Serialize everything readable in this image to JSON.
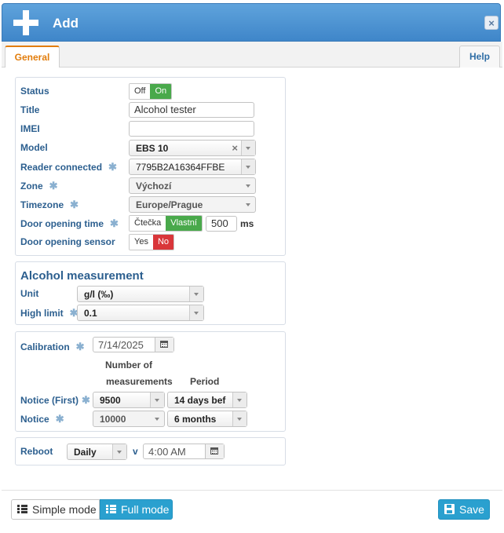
{
  "dialog": {
    "title": "Add",
    "close_label": "×"
  },
  "tabs": {
    "general": "General",
    "help": "Help"
  },
  "general": {
    "status_label": "Status",
    "status_off": "Off",
    "status_on": "On",
    "title_label": "Title",
    "title_value": "Alcohol tester",
    "imei_label": "IMEI",
    "imei_value": "",
    "model_label": "Model",
    "model_value": "EBS 10",
    "model_clear": "×",
    "reader_label": "Reader connected",
    "reader_value": "7795B2A16364FFBE",
    "zone_label": "Zone",
    "zone_value": "Výchozí",
    "timezone_label": "Timezone",
    "timezone_value": "Europe/Prague",
    "door_time_label": "Door opening time",
    "door_time_opt1": "Čtečka",
    "door_time_opt2": "Vlastní",
    "door_time_value": "500",
    "door_time_unit": "ms",
    "door_sensor_label": "Door opening sensor",
    "door_sensor_yes": "Yes",
    "door_sensor_no": "No"
  },
  "alcohol": {
    "heading": "Alcohol measurement",
    "unit_label": "Unit",
    "unit_value": "g/l (‰)",
    "high_limit_label": "High limit",
    "high_limit_value": "0.1"
  },
  "calibration": {
    "label": "Calibration",
    "date_value": "7/14/2025",
    "col_measure_line1": "Number of",
    "col_measure_line2": "measurements",
    "col_period": "Period",
    "notice_first_label": "Notice (First)",
    "notice_first_count": "9500",
    "notice_first_period": "14 days bef",
    "notice_label": "Notice",
    "notice_count": "10000",
    "notice_period": "6 months"
  },
  "reboot": {
    "label": "Reboot",
    "freq_value": "Daily",
    "sep": "v",
    "time_value": "4:00 AM"
  },
  "footer": {
    "simple_mode": "Simple mode",
    "full_mode": "Full mode",
    "save": "Save"
  },
  "colors": {
    "header": "#3f86c9",
    "accent_orange": "#e27d0c",
    "toggle_on": "#49a94b",
    "toggle_no": "#d9363a",
    "button": "#2aa0cf"
  }
}
